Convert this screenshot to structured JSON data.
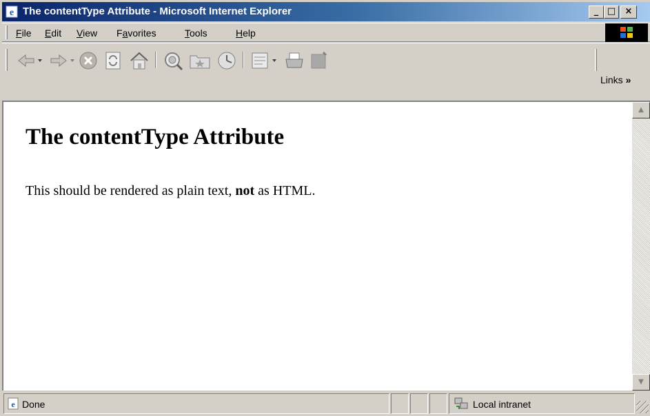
{
  "window": {
    "title": "The contentType Attribute - Microsoft Internet Explorer",
    "controls": [
      "_",
      "□",
      "×"
    ]
  },
  "menu": {
    "items": [
      {
        "label": "File",
        "mnemonic": "F"
      },
      {
        "label": "Edit",
        "mnemonic": "E"
      },
      {
        "label": "View",
        "mnemonic": "V"
      },
      {
        "label": "Favorites",
        "mnemonic": "a"
      },
      {
        "label": "Tools",
        "mnemonic": "T"
      },
      {
        "label": "Help",
        "mnemonic": "H"
      }
    ]
  },
  "toolbar": {
    "buttons": [
      "back-icon",
      "forward-icon",
      "stop-icon",
      "refresh-icon",
      "home-icon",
      "search-icon",
      "favorites-icon",
      "history-icon",
      "mail-icon",
      "print-icon",
      "edit-icon"
    ],
    "links_label": "Links",
    "links_chevron": "»"
  },
  "document": {
    "heading": "The contentType Attribute",
    "para_before": "This should be rendered as plain text, ",
    "para_bold": "not",
    "para_after": " as HTML."
  },
  "status": {
    "text": "Done",
    "zone": "Local intranet"
  },
  "colors": {
    "title_start": "#0a246a",
    "title_end": "#a6caf0",
    "chrome": "#d4d0c8"
  }
}
